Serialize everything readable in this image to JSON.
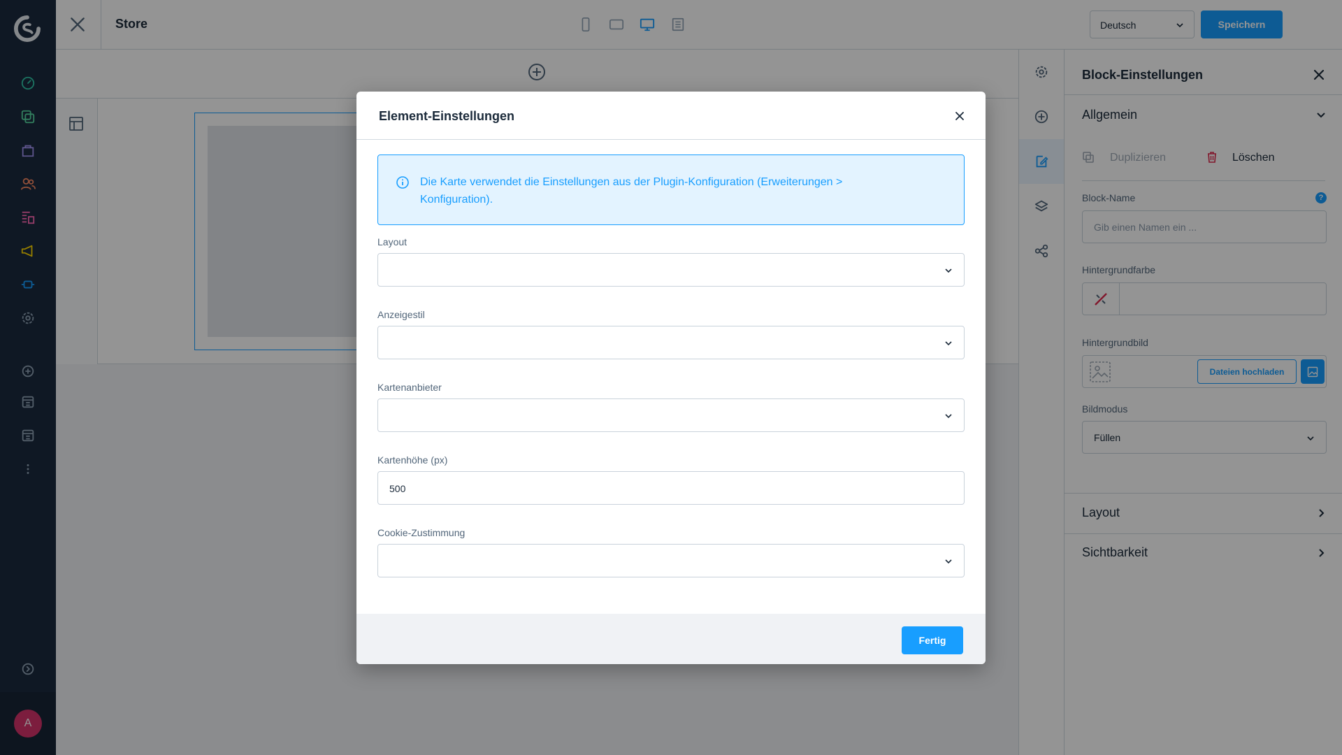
{
  "app": {
    "logo": "shopware-logo-icon",
    "avatar_initial": "A"
  },
  "sidebar": {
    "items": [
      {
        "icon": "dashboard-icon",
        "color": "#31c6a8"
      },
      {
        "icon": "catalogue-icon",
        "color": "#57d9a3"
      },
      {
        "icon": "orders-icon",
        "color": "#a092f0"
      },
      {
        "icon": "customers-icon",
        "color": "#f88962"
      },
      {
        "icon": "content-icon",
        "color": "#ff68b4"
      },
      {
        "icon": "marketing-icon",
        "color": "#ffd700"
      },
      {
        "icon": "extensions-icon",
        "color": "#189eff"
      },
      {
        "icon": "settings-icon",
        "color": "#8fa2b5"
      },
      {
        "icon": "add-sales-channel-icon",
        "color": "#8fa2b5"
      },
      {
        "icon": "sales-channel-icon",
        "color": "#8fa2b5"
      },
      {
        "icon": "sales-channel-icon",
        "color": "#8fa2b5"
      },
      {
        "icon": "more-icon",
        "color": "#8fa2b5"
      }
    ]
  },
  "topbar": {
    "title": "Store",
    "language": "Deutsch",
    "save_label": "Speichern"
  },
  "panel": {
    "title": "Block-Einstellungen",
    "section_general": "Allgemein",
    "duplicate_label": "Duplizieren",
    "delete_label": "Löschen",
    "block_name_label": "Block-Name",
    "block_name_placeholder": "Gib einen Namen ein ...",
    "help_mark": "?",
    "bg_color_label": "Hintergrundfarbe",
    "bg_image_label": "Hintergrundbild",
    "upload_label": "Dateien hochladen",
    "image_mode_label": "Bildmodus",
    "image_mode_value": "Füllen",
    "section_layout": "Layout",
    "section_visibility": "Sichtbarkeit"
  },
  "modal": {
    "title": "Element-Einstellungen",
    "info_text": "Die Karte verwendet die Einstellungen aus der Plugin-Konfiguration (Erweiterungen > Konfiguration).",
    "fields": {
      "layout_label": "Layout",
      "display_style_label": "Anzeigestil",
      "map_provider_label": "Kartenanbieter",
      "map_height_label": "Kartenhöhe (px)",
      "map_height_value": "500",
      "cookie_label": "Cookie-Zustimmung"
    },
    "done_label": "Fertig"
  },
  "colors": {
    "accent": "#189eff",
    "sidebar_bg": "#1b2a3f",
    "danger": "#de294c",
    "text": "#1b2a3a"
  }
}
